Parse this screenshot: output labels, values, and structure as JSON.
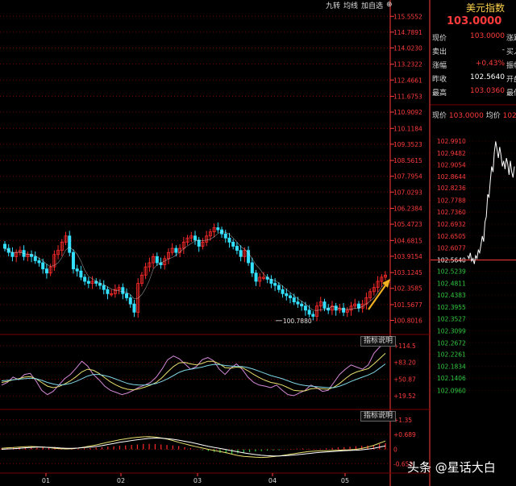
{
  "toolbar": {
    "items": [
      "九转",
      "均线",
      "加自选",
      "⊕"
    ]
  },
  "header": {
    "title": "美元指数",
    "price": "103.0000"
  },
  "quote": [
    {
      "label": "现价",
      "value": "103.0000",
      "ext": "涨跌",
      "color": "#ff3b3b"
    },
    {
      "label": "卖出",
      "value": "-",
      "ext": "买入",
      "color": "#dddddd"
    },
    {
      "label": "涨幅",
      "value": "+0.43%",
      "ext": "振幅",
      "color": "#ff3b3b"
    },
    {
      "label": "昨收",
      "value": "102.5640",
      "ext": "开盘",
      "color": "#ffffff"
    },
    {
      "label": "最高",
      "value": "103.0360",
      "ext": "最低",
      "color": "#ff3b3b"
    }
  ],
  "mini_head": {
    "l1": "现价",
    "v1": "103.0000",
    "l2": "均价",
    "v2": "102"
  },
  "buttons": {
    "ind1": "指标说明",
    "ind2": "指标说明"
  },
  "watermark": {
    "text": "头条 @星话大白"
  },
  "colors": {
    "up": "#ff2a2a",
    "down": "#33e0ff",
    "grid": "#7a0000",
    "axis": "#ff3b3b",
    "ma": "#e6e6e6"
  },
  "chart_data": [
    {
      "type": "candlestick",
      "x_ticks": [
        "01",
        "02",
        "03",
        "04",
        "05"
      ],
      "y_ticks": [
        "115.5552",
        "114.7891",
        "114.0230",
        "113.2322",
        "112.4661",
        "111.6753",
        "110.9092",
        "110.1184",
        "109.3523",
        "108.5615",
        "107.7954",
        "107.0293",
        "106.2384",
        "105.4723",
        "104.6815",
        "103.9154",
        "103.1245",
        "102.3585",
        "101.5677",
        "100.8016"
      ],
      "ylim": [
        100.55,
        115.8
      ],
      "annotation": "100.7880",
      "closes": [
        104.3,
        104.1,
        103.9,
        104.1,
        104.2,
        103.9,
        104.0,
        103.9,
        103.7,
        103.6,
        103.3,
        103.1,
        103.4,
        104.0,
        104.2,
        104.6,
        104.9,
        104.1,
        103.3,
        103.2,
        102.9,
        102.7,
        102.6,
        102.7,
        102.6,
        102.5,
        102.3,
        102.1,
        102.1,
        102.3,
        102.4,
        102.1,
        101.9,
        101.6,
        101.2,
        102.6,
        103.0,
        103.4,
        103.6,
        103.9,
        103.6,
        103.5,
        103.8,
        104.1,
        104.3,
        104.1,
        104.3,
        104.6,
        104.8,
        104.9,
        104.7,
        104.4,
        104.6,
        104.9,
        105.1,
        105.3,
        105.2,
        105.0,
        104.8,
        104.6,
        104.4,
        104.2,
        103.9,
        104.2,
        103.6,
        103.1,
        102.7,
        102.9,
        102.9,
        102.8,
        102.6,
        102.5,
        102.3,
        102.1,
        102.0,
        101.9,
        101.7,
        101.6,
        101.5,
        101.3,
        101.1,
        101.0,
        101.5,
        101.7,
        101.4,
        101.3,
        101.5,
        101.3,
        101.4,
        101.2,
        101.3,
        101.5,
        101.6,
        101.4,
        101.6,
        101.9,
        102.2,
        102.4,
        102.7,
        102.9,
        103.0
      ],
      "opens": [
        104.5,
        104.3,
        104.1,
        103.9,
        104.1,
        104.2,
        103.9,
        104.0,
        103.9,
        103.7,
        103.6,
        103.3,
        103.1,
        103.4,
        104.0,
        104.2,
        104.6,
        104.9,
        104.1,
        103.3,
        103.2,
        102.9,
        102.7,
        102.6,
        102.7,
        102.6,
        102.5,
        102.3,
        102.1,
        102.1,
        102.3,
        102.4,
        102.1,
        101.9,
        101.6,
        101.2,
        102.6,
        103.0,
        103.4,
        103.6,
        103.9,
        103.6,
        103.5,
        103.8,
        104.1,
        104.3,
        104.1,
        104.3,
        104.6,
        104.8,
        104.9,
        104.7,
        104.4,
        104.6,
        104.9,
        105.1,
        105.3,
        105.2,
        105.0,
        104.8,
        104.6,
        104.4,
        104.2,
        103.9,
        104.2,
        103.6,
        103.1,
        102.7,
        102.9,
        102.9,
        102.8,
        102.6,
        102.5,
        102.3,
        102.1,
        102.0,
        101.9,
        101.7,
        101.6,
        101.5,
        101.3,
        101.1,
        101.0,
        101.5,
        101.7,
        101.4,
        101.3,
        101.5,
        101.3,
        101.4,
        101.2,
        101.3,
        101.5,
        101.6,
        101.4,
        101.6,
        101.9,
        102.2,
        102.4,
        102.7,
        102.9
      ]
    },
    {
      "type": "line",
      "y_ticks": [
        "114.5",
        "83.20",
        "50.87",
        "19.52"
      ],
      "ylim": [
        0,
        125
      ],
      "series": [
        {
          "color": "#d58ad8",
          "values": [
            40,
            45,
            55,
            50,
            60,
            62,
            48,
            30,
            22,
            28,
            40,
            52,
            60,
            72,
            85,
            76,
            60,
            50,
            38,
            30,
            26,
            22,
            25,
            30,
            36,
            40,
            45,
            55,
            70,
            88,
            95,
            90,
            80,
            70,
            75,
            88,
            92,
            86,
            70,
            60,
            72,
            80,
            70,
            55,
            45,
            40,
            38,
            35,
            40,
            30,
            22,
            20,
            25,
            30,
            40,
            35,
            28,
            30,
            45,
            60,
            70,
            78,
            74,
            70,
            78,
            100,
            112,
            118
          ]
        },
        {
          "color": "#e8e070",
          "values": [
            45,
            47,
            50,
            52,
            55,
            56,
            52,
            45,
            38,
            35,
            37,
            42,
            48,
            56,
            65,
            70,
            68,
            62,
            54,
            46,
            40,
            35,
            32,
            31,
            33,
            36,
            40,
            45,
            54,
            65,
            75,
            82,
            83,
            80,
            78,
            81,
            85,
            85,
            80,
            73,
            72,
            74,
            73,
            67,
            60,
            54,
            49,
            45,
            43,
            40,
            35,
            30,
            29,
            29,
            33,
            34,
            33,
            32,
            36,
            43,
            52,
            60,
            65,
            68,
            71,
            80,
            90,
            100
          ]
        },
        {
          "color": "#7fd6e6",
          "values": [
            48,
            49,
            50,
            51,
            52,
            53,
            52,
            49,
            45,
            42,
            40,
            41,
            43,
            47,
            52,
            57,
            60,
            60,
            58,
            55,
            51,
            47,
            43,
            41,
            40,
            40,
            41,
            43,
            47,
            52,
            58,
            64,
            68,
            70,
            72,
            74,
            77,
            79,
            79,
            77,
            76,
            75,
            75,
            73,
            70,
            66,
            62,
            58,
            55,
            52,
            48,
            44,
            41,
            39,
            38,
            37,
            36,
            35,
            35,
            38,
            42,
            47,
            51,
            55,
            59,
            64,
            72,
            80
          ]
        }
      ]
    },
    {
      "type": "bar+line",
      "y_ticks": [
        "1.35",
        "0.689",
        "0",
        "-0.653"
      ],
      "ylim": [
        -0.9,
        1.6
      ],
      "hist": [
        0.05,
        0.08,
        0.1,
        0.12,
        0.1,
        0.08,
        0.07,
        0.09,
        0.11,
        0.1,
        0.08,
        0.06,
        0.04,
        0.03,
        0.05,
        0.06,
        0.08,
        0.1,
        0.12,
        0.14,
        0.16,
        0.18,
        0.2,
        0.22,
        0.24,
        0.25,
        0.24,
        0.22,
        0.2,
        0.18,
        0.15,
        0.1,
        0.05,
        0.0,
        -0.04,
        -0.08,
        -0.12,
        -0.16,
        -0.18,
        -0.2,
        -0.18,
        -0.15,
        -0.12,
        -0.1,
        -0.08,
        -0.06,
        -0.05,
        -0.04,
        0.0,
        0.02,
        0.03,
        0.04,
        0.03,
        0.02,
        0.03,
        0.05,
        0.07,
        0.09,
        0.1,
        0.12,
        0.14,
        0.16,
        0.18,
        0.2,
        0.24,
        0.28
      ],
      "series": [
        {
          "color": "#e8e070",
          "values": [
            0.05,
            0.07,
            0.08,
            0.1,
            0.12,
            0.13,
            0.12,
            0.1,
            0.08,
            0.05,
            0.03,
            0.02,
            0.03,
            0.06,
            0.1,
            0.15,
            0.2,
            0.26,
            0.32,
            0.38,
            0.44,
            0.48,
            0.52,
            0.55,
            0.57,
            0.58,
            0.56,
            0.52,
            0.47,
            0.4,
            0.32,
            0.25,
            0.18,
            0.12,
            0.06,
            0.0,
            -0.05,
            -0.1,
            -0.15,
            -0.22,
            -0.28,
            -0.32,
            -0.34,
            -0.36,
            -0.37,
            -0.36,
            -0.33,
            -0.3,
            -0.26,
            -0.22,
            -0.18,
            -0.14,
            -0.1,
            -0.08,
            -0.07,
            -0.06,
            -0.05,
            -0.04,
            -0.03,
            -0.02,
            0.0,
            0.04,
            0.1,
            0.18,
            0.28,
            0.38
          ]
        },
        {
          "color": "#ffffff",
          "values": [
            0.0,
            0.02,
            0.03,
            0.05,
            0.07,
            0.09,
            0.1,
            0.1,
            0.09,
            0.08,
            0.06,
            0.05,
            0.05,
            0.06,
            0.08,
            0.1,
            0.13,
            0.17,
            0.22,
            0.27,
            0.32,
            0.36,
            0.4,
            0.44,
            0.47,
            0.5,
            0.51,
            0.51,
            0.49,
            0.46,
            0.42,
            0.37,
            0.32,
            0.26,
            0.2,
            0.14,
            0.09,
            0.04,
            -0.01,
            -0.06,
            -0.11,
            -0.16,
            -0.2,
            -0.24,
            -0.27,
            -0.29,
            -0.3,
            -0.3,
            -0.29,
            -0.27,
            -0.25,
            -0.22,
            -0.19,
            -0.16,
            -0.14,
            -0.12,
            -0.1,
            -0.08,
            -0.06,
            -0.05,
            -0.04,
            -0.02,
            0.01,
            0.05,
            0.1,
            0.16
          ]
        }
      ]
    },
    {
      "type": "line",
      "y_ticks": [
        "102.9910",
        "102.9482",
        "102.9054",
        "102.8644",
        "102.8236",
        "102.7788",
        "102.7360",
        "102.6932",
        "102.6505",
        "102.6077",
        "102.5640",
        "102.5239",
        "102.4811",
        "102.4383",
        "102.3955",
        "102.3527",
        "102.3099",
        "102.2672",
        "102.2261",
        "102.1834",
        "102.1406",
        "102.0960"
      ],
      "ylim": [
        102.08,
        103.02
      ],
      "reference": 102.564,
      "values": [
        102.58,
        102.57,
        102.59,
        102.56,
        102.57,
        102.55,
        102.58,
        102.57,
        102.6,
        102.59,
        102.62,
        102.65,
        102.63,
        102.7,
        102.72,
        102.8,
        102.79,
        102.85,
        102.9,
        102.88,
        102.95,
        102.99,
        102.96,
        102.93,
        102.97,
        102.94,
        102.9,
        102.92,
        102.89,
        102.93,
        102.91,
        102.87,
        102.92,
        102.88,
        102.86,
        102.9
      ]
    }
  ]
}
